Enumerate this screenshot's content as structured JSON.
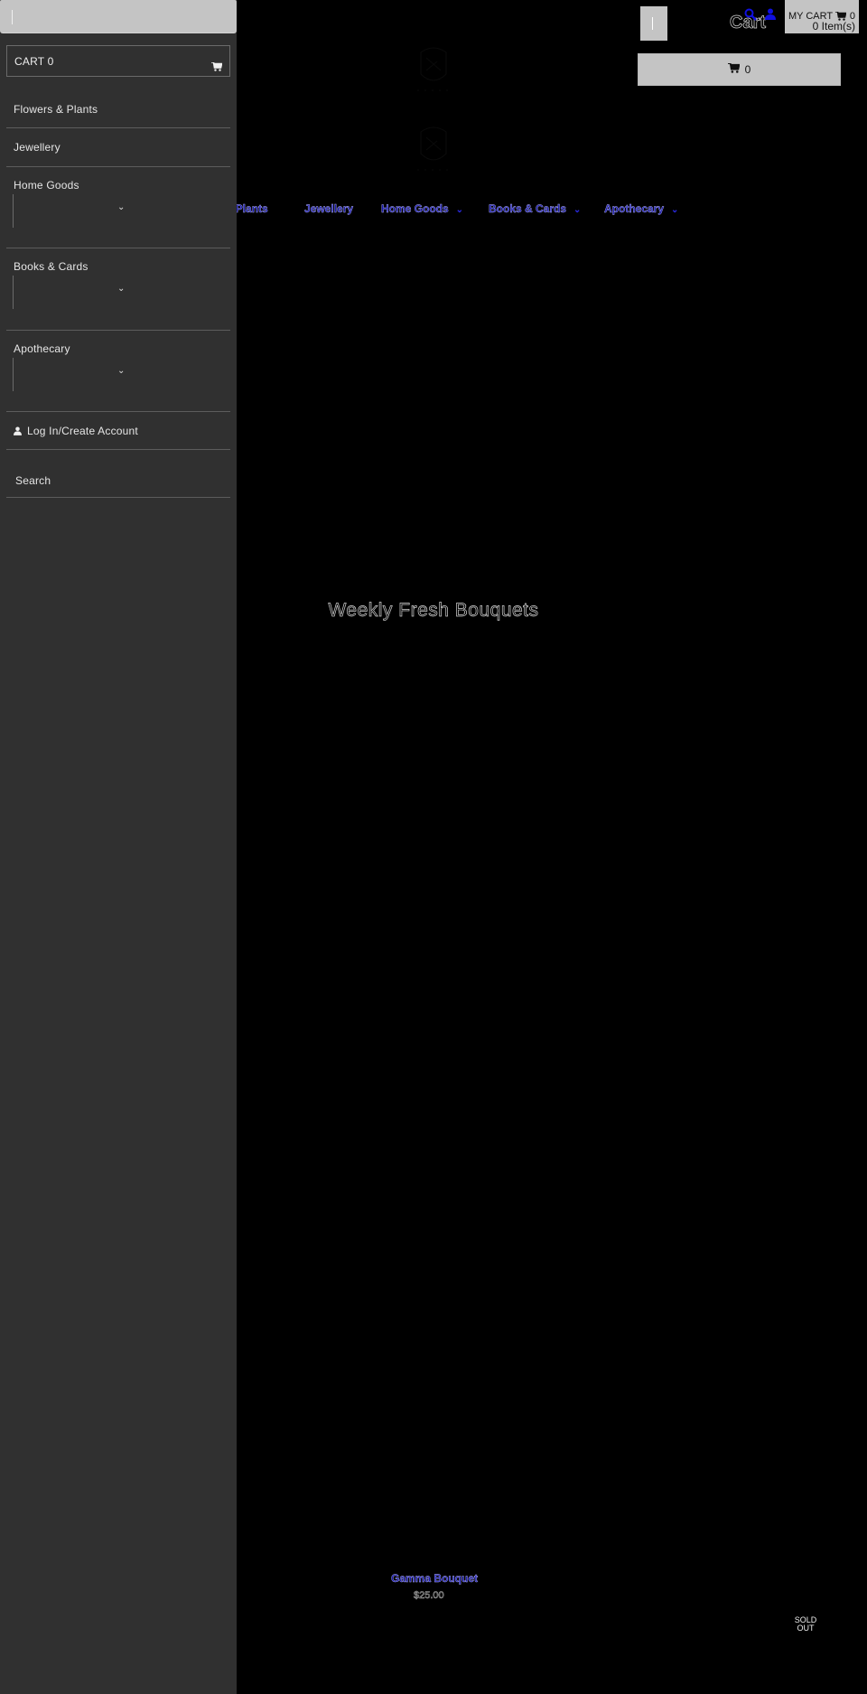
{
  "header": {
    "cart_overlay_text": "Cart",
    "my_cart_label": "MY CART",
    "my_cart_count": "0",
    "my_cart_items": "0 Item(s)",
    "wide_cart_count": "0",
    "icons": {
      "search": "search-icon",
      "user": "user-icon",
      "cart": "cart-icon"
    }
  },
  "nav": {
    "items": [
      {
        "label": "Flowers & Plants",
        "has_dropdown": false
      },
      {
        "label": "Jewellery",
        "has_dropdown": false
      },
      {
        "label": "Home Goods",
        "has_dropdown": true
      },
      {
        "label": "Books & Cards",
        "has_dropdown": true
      },
      {
        "label": "Apothecary",
        "has_dropdown": true
      }
    ],
    "visible_first_label": "& Plants",
    "chevron": "⌄"
  },
  "hero": {
    "title": "Weekly Fresh Bouquets"
  },
  "product": {
    "title": "Gamma Bouquet",
    "price": "$25.00",
    "badge": "SOLD OUT"
  },
  "drawer": {
    "search_value": "",
    "cart_label": "CART 0",
    "items": [
      {
        "label": "Flowers & Plants",
        "has_submenu": false
      },
      {
        "label": "Jewellery",
        "has_submenu": false
      },
      {
        "label": "Home Goods",
        "has_submenu": true
      },
      {
        "label": "Books & Cards",
        "has_submenu": true
      },
      {
        "label": "Apothecary",
        "has_submenu": true
      }
    ],
    "account_label": "Log In/Create Account",
    "search_label": "Search",
    "chevron": "⌄"
  },
  "colors": {
    "background": "#000000",
    "drawer_background": "#303030",
    "button_gray": "#c4c4c4",
    "nav_link": "#1a1aa8",
    "icon_blue": "#1010e0"
  }
}
